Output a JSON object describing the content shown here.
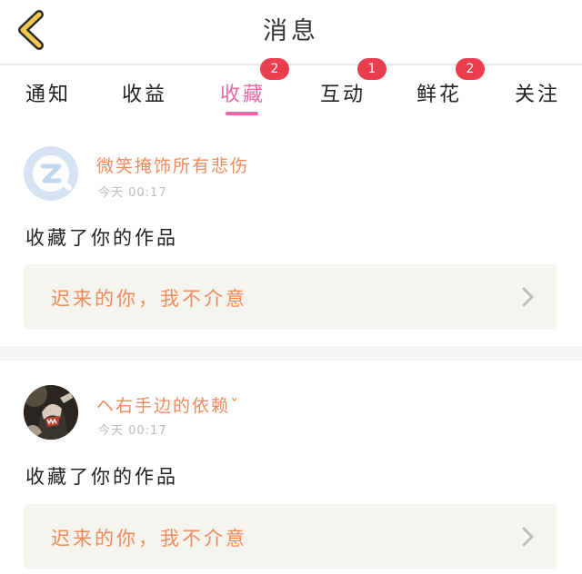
{
  "header": {
    "title": "消息",
    "back_icon": "chevron-left-icon",
    "back_color": "#f2c94c"
  },
  "tabs": [
    {
      "label": "通知",
      "badge": ""
    },
    {
      "label": "收益",
      "badge": ""
    },
    {
      "label": "收藏",
      "badge": "2",
      "active": true
    },
    {
      "label": "互动",
      "badge": "1"
    },
    {
      "label": "鲜花",
      "badge": "2"
    },
    {
      "label": "关注",
      "badge": ""
    }
  ],
  "colors": {
    "accent": "#e76aa6",
    "badge": "#ea3d4e",
    "username": "#f08a5d"
  },
  "messages": [
    {
      "username": "微笑掩饰所有悲伤",
      "time": "今天 00:17",
      "action": "收藏了你的作品",
      "work_title": "迟来的你，我不介意",
      "avatar": "qq-default-avatar-icon"
    },
    {
      "username": "ヘ右手边的依赖ˇ",
      "time": "今天 00:17",
      "action": "收藏了你的作品",
      "work_title": "迟来的你，我不介意",
      "avatar": "user-photo-avatar"
    }
  ]
}
